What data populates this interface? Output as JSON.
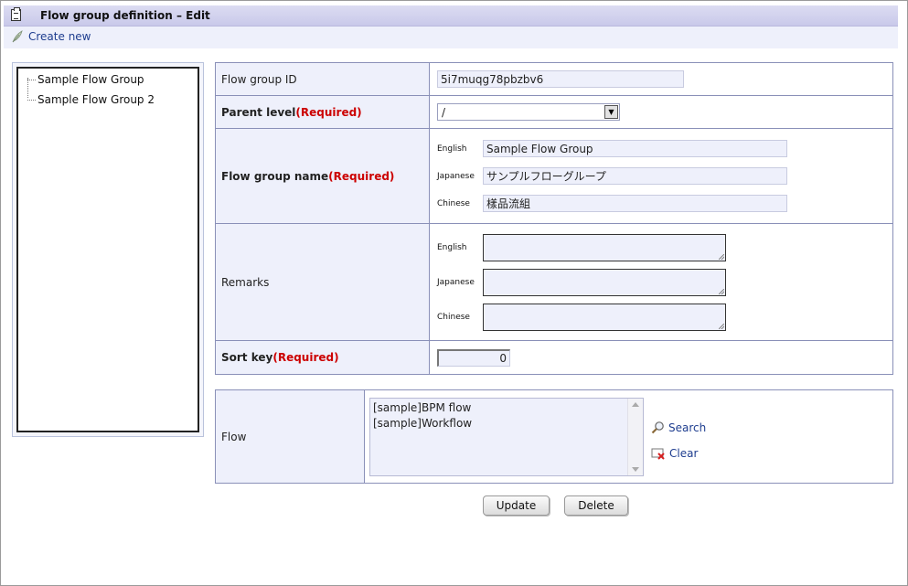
{
  "header": {
    "title": "Flow group definition – Edit"
  },
  "toolbar": {
    "create_new": "Create new"
  },
  "tree": {
    "items": [
      "Sample Flow Group",
      "Sample Flow Group 2"
    ]
  },
  "form": {
    "flow_group_id": {
      "label": "Flow group ID",
      "value": "5i7muqg78pbzbv6"
    },
    "parent_level": {
      "label": "Parent level",
      "required": "(Required)",
      "value": "/"
    },
    "flow_group_name": {
      "label": "Flow group name",
      "required": "(Required)",
      "english_label": "English",
      "english_value": "Sample Flow Group",
      "japanese_label": "Japanese",
      "japanese_value": "サンプルフローグループ",
      "chinese_label": "Chinese",
      "chinese_value": "樣品流組"
    },
    "remarks": {
      "label": "Remarks",
      "english_label": "English",
      "english_value": "",
      "japanese_label": "Japanese",
      "japanese_value": "",
      "chinese_label": "Chinese",
      "chinese_value": ""
    },
    "sort_key": {
      "label": "Sort key",
      "required": "(Required)",
      "value": "0"
    }
  },
  "flow": {
    "label": "Flow",
    "options": [
      "[sample]BPM flow",
      "[sample]Workflow"
    ],
    "search_label": "Search",
    "clear_label": "Clear"
  },
  "buttons": {
    "update": "Update",
    "delete": "Delete"
  },
  "colors": {
    "accent": "#1e3d8f",
    "required": "#cc0000",
    "header_bg": "#d3d3ee",
    "field_bg": "#eef0fb"
  }
}
